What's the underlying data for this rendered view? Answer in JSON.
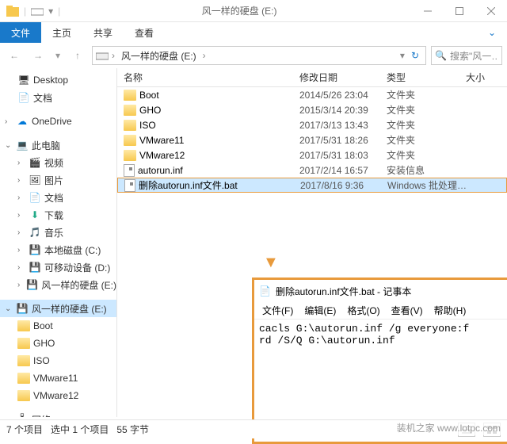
{
  "titlebar": {
    "title": "风一样的硬盘 (E:)"
  },
  "menubar": {
    "file": "文件",
    "home": "主页",
    "share": "共享",
    "view": "查看"
  },
  "address": {
    "crumb1": "风一样的硬盘 (E:)"
  },
  "search": {
    "placeholder": "搜索\"风一…"
  },
  "tree": {
    "desktop": "Desktop",
    "documents": "文档",
    "onedrive": "OneDrive",
    "thispc": "此电脑",
    "videos": "视频",
    "pictures": "图片",
    "docs2": "文档",
    "downloads": "下载",
    "music": "音乐",
    "localdisk_c": "本地磁盘 (C:)",
    "removable_d": "可移动设备 (D:)",
    "drive_e": "风一样的硬盘 (E:)",
    "drive_e2": "风一样的硬盘 (E:)",
    "boot": "Boot",
    "gho": "GHO",
    "iso": "ISO",
    "vmware11": "VMware11",
    "vmware12": "VMware12",
    "network": "网络"
  },
  "columns": {
    "name": "名称",
    "date": "修改日期",
    "type": "类型",
    "size": "大小"
  },
  "files": [
    {
      "name": "Boot",
      "date": "2014/5/26 23:04",
      "type": "文件夹",
      "kind": "folder"
    },
    {
      "name": "GHO",
      "date": "2015/3/14 20:39",
      "type": "文件夹",
      "kind": "folder"
    },
    {
      "name": "ISO",
      "date": "2017/3/13 13:43",
      "type": "文件夹",
      "kind": "folder"
    },
    {
      "name": "VMware11",
      "date": "2017/5/31 18:26",
      "type": "文件夹",
      "kind": "folder"
    },
    {
      "name": "VMware12",
      "date": "2017/5/31 18:03",
      "type": "文件夹",
      "kind": "folder"
    },
    {
      "name": "autorun.inf",
      "date": "2017/2/14 16:57",
      "type": "安装信息",
      "kind": "file"
    },
    {
      "name": "删除autorun.inf文件.bat",
      "date": "2017/8/16 9:36",
      "type": "Windows 批处理…",
      "kind": "file",
      "selected": true
    }
  ],
  "notepad": {
    "title": "删除autorun.inf文件.bat - 记事本",
    "menu": {
      "file": "文件(F)",
      "edit": "编辑(E)",
      "format": "格式(O)",
      "view": "查看(V)",
      "help": "帮助(H)"
    },
    "content": "cacls G:\\autorun.inf /g everyone:f\nrd /S/Q G:\\autorun.inf"
  },
  "status": {
    "count": "7 个项目",
    "selected": "选中 1 个项目",
    "size": "55 字节"
  },
  "watermark": "装机之家 www.lotpc.com"
}
